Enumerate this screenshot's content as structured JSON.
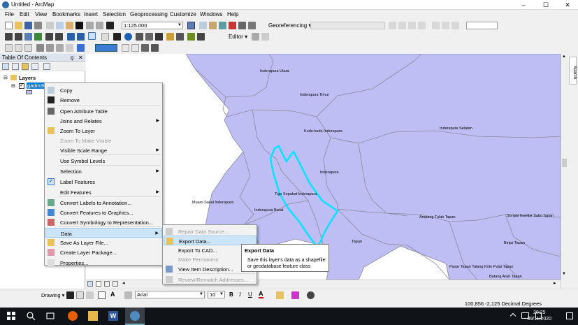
{
  "window": {
    "title": "Untitled - ArcMap",
    "controls": [
      "–",
      "☐",
      "✕"
    ]
  },
  "menubar": [
    "File",
    "Edit",
    "View",
    "Bookmarks",
    "Insert",
    "Selection",
    "Geoprocessing",
    "Customize",
    "Windows",
    "Help"
  ],
  "toolbar": {
    "scale": "1:125.000",
    "editor_label": "Editor",
    "georef_label": "Georeferencing"
  },
  "toc": {
    "title": "Table Of Contents",
    "pin": "ϙ",
    "close": "✕",
    "root": "Layers",
    "layer": "gadm36_..."
  },
  "context_menu": {
    "items": [
      {
        "label": "Copy",
        "icon": "copy-icon"
      },
      {
        "label": "Remove",
        "icon": "remove-icon"
      },
      {
        "label": "Open Attribute Table",
        "icon": "table-icon"
      },
      {
        "label": "Joins and Relates",
        "submenu": true
      },
      {
        "label": "Zoom To Layer",
        "icon": "zoom-layer-icon"
      },
      {
        "label": "Zoom To Make Visible",
        "disabled": true
      },
      {
        "label": "Visible Scale Range",
        "submenu": true
      },
      {
        "label": "Use Symbol Levels"
      },
      {
        "label": "Selection",
        "submenu": true
      },
      {
        "label": "Label Features",
        "checked": true
      },
      {
        "label": "Edit Features",
        "submenu": true
      },
      {
        "label": "Convert Labels to Annotation...",
        "icon": "annotation-icon"
      },
      {
        "label": "Convert Features to Graphics...",
        "icon": "graphics-icon"
      },
      {
        "label": "Convert Symbology to Representation...",
        "icon": "representation-icon"
      },
      {
        "label": "Data",
        "submenu": true,
        "highlighted": true
      },
      {
        "label": "Save As Layer File...",
        "icon": "save-layer-icon"
      },
      {
        "label": "Create Layer Package...",
        "icon": "package-icon"
      },
      {
        "label": "Properties...",
        "icon": "properties-icon"
      }
    ]
  },
  "data_submenu": {
    "items": [
      {
        "label": "Repair Data Source...",
        "disabled": true
      },
      {
        "label": "Export Data...",
        "highlighted": true
      },
      {
        "label": "Export To CAD..."
      },
      {
        "label": "Make Permanent",
        "disabled": true
      },
      {
        "label": "View Item Description..."
      },
      {
        "label": "Review/Rematch Addresses...",
        "disabled": true
      }
    ]
  },
  "tooltip": {
    "title": "Export Data",
    "body": "Save this layer's data as a shapefile or geodatabase feature class"
  },
  "map": {
    "fill_color": "#bebef5",
    "border_color": "#8a8a9a",
    "highlight_color": "#00e5ff",
    "labels": [
      "Inderapura Utara",
      "Inderapura Timur",
      "Kudo-kudo Inderapura",
      "Inderapura Selatan",
      "Inderapura",
      "Tigo Sepakat Inderapura",
      "Muaro Sakai Inderapura",
      "Inderapura Barat",
      "Ampang Tulak Tapan",
      "Sungai Gambir Sako Tapan",
      "Tapan",
      "Binjai Tapan",
      "Pasar Tapan Talang Koto Pulai Tapan",
      "Batang Arah Tapan"
    ]
  },
  "search_tab": "Search",
  "drawbar": {
    "drawing_label": "Drawing",
    "font": "Arial",
    "size": "10",
    "bold": "B",
    "italic": "I",
    "underline": "U"
  },
  "status": {
    "coords": "100,856  -2,125 Decimal Degrees"
  },
  "taskbar": {
    "time": "20:25",
    "date": "09/11/2020"
  }
}
